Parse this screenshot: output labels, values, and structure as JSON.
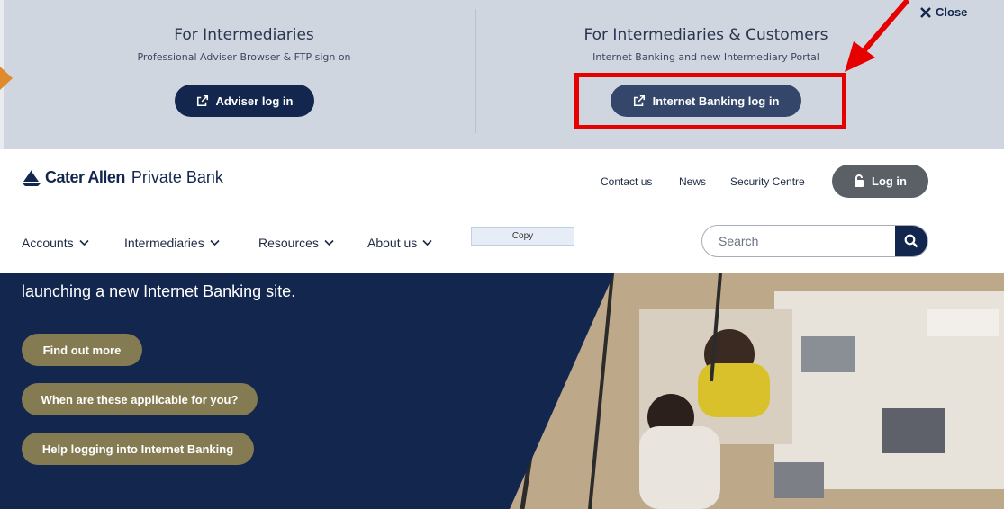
{
  "topbar": {
    "left_title": "For Intermediaries",
    "left_sub": "Professional Adviser Browser & FTP sign on",
    "adviser_button": "Adviser log in",
    "right_title": "For Intermediaries & Customers",
    "right_sub": "Internet Banking and new Intermediary Portal",
    "ib_button": "Internet Banking log in",
    "close_label": "Close",
    "highlight_color": "#e60000"
  },
  "header": {
    "brand_bold": "Cater Allen",
    "brand_light": "Private Bank",
    "util_links": [
      "Contact us",
      "News",
      "Security Centre"
    ],
    "login_label": "Log in",
    "nav": [
      "Accounts",
      "Intermediaries",
      "Resources",
      "About us"
    ],
    "copy_label": "Copy",
    "search_placeholder": "Search"
  },
  "hero": {
    "lead": "launching a new Internet Banking site.",
    "buttons": [
      "Find out more",
      "When are these applicable for you?",
      "Help logging into Internet Banking"
    ]
  },
  "colors": {
    "navy": "#13264d",
    "topbar_bg": "#cfd6df",
    "olive_button": "#857b52",
    "login_grey": "#5b5f66"
  }
}
